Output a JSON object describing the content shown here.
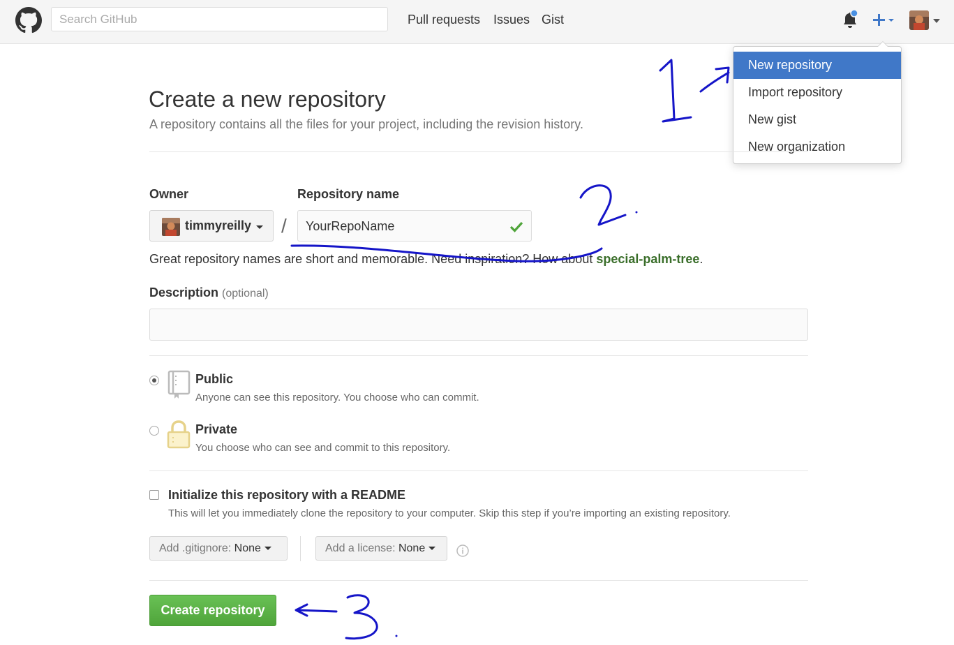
{
  "header": {
    "search_placeholder": "Search GitHub",
    "nav": [
      "Pull requests",
      "Issues",
      "Gist"
    ]
  },
  "new_menu": {
    "items": [
      "New repository",
      "Import repository",
      "New gist",
      "New organization"
    ],
    "active_index": 0
  },
  "page": {
    "title": "Create a new repository",
    "subtitle": "A repository contains all the files for your project, including the revision history.",
    "owner_label": "Owner",
    "owner_value": "timmyreilly",
    "repo_name_label": "Repository name",
    "repo_name_value": "YourRepoName",
    "hint_prefix": "Great repository names are short and memorable. Need inspiration? How about ",
    "hint_suggestion": "special-palm-tree",
    "hint_suffix": ".",
    "description_label": "Description",
    "description_optional": "(optional)",
    "visibility": {
      "selected": "Public",
      "public_title": "Public",
      "public_desc": "Anyone can see this repository. You choose who can commit.",
      "private_title": "Private",
      "private_desc": "You choose who can see and commit to this repository."
    },
    "readme_label": "Initialize this repository with a README",
    "readme_desc": "This will let you immediately clone the repository to your computer. Skip this step if you’re importing an existing repository.",
    "gitignore_label": "Add .gitignore:",
    "gitignore_value": "None",
    "license_label": "Add a license:",
    "license_value": "None",
    "create_button": "Create repository"
  },
  "annotations": [
    "1",
    "2",
    "3"
  ],
  "colors": {
    "accent_blue": "#4078c8",
    "create_green": "#55a532",
    "suggestion_green": "#3a6e2a",
    "ink_blue": "#1111cc"
  }
}
